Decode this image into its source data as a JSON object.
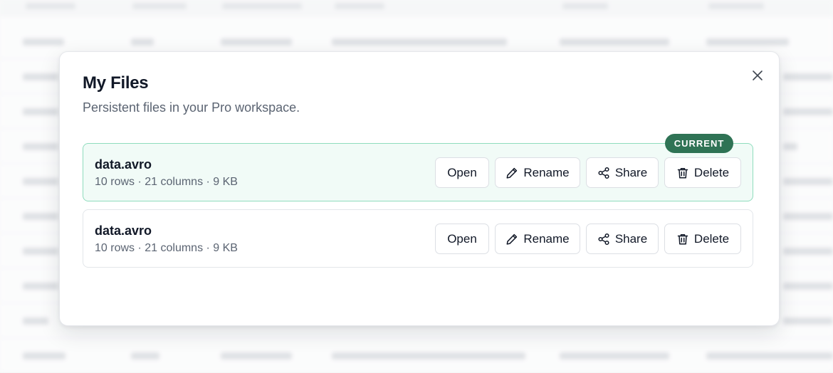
{
  "modal": {
    "title": "My Files",
    "subtitle": "Persistent files in your Pro workspace."
  },
  "files": [
    {
      "name": "data.avro",
      "meta": "10 rows · 21 columns · 9 KB",
      "is_current": true,
      "badge": "CURRENT",
      "actions": {
        "open": "Open",
        "rename": "Rename",
        "share": "Share",
        "delete": "Delete"
      }
    },
    {
      "name": "data.avro",
      "meta": "10 rows · 21 columns · 9 KB",
      "is_current": false,
      "actions": {
        "open": "Open",
        "rename": "Rename",
        "share": "Share",
        "delete": "Delete"
      }
    }
  ],
  "icons": {
    "close": "close-icon",
    "rename": "pencil-icon",
    "share": "share-icon",
    "delete": "trash-icon"
  },
  "colors": {
    "current_badge": "#2f7355",
    "current_card_bg": "#f1fbf7",
    "current_card_border": "#8fdcbd",
    "title": "#111827",
    "muted": "#5b6472"
  }
}
